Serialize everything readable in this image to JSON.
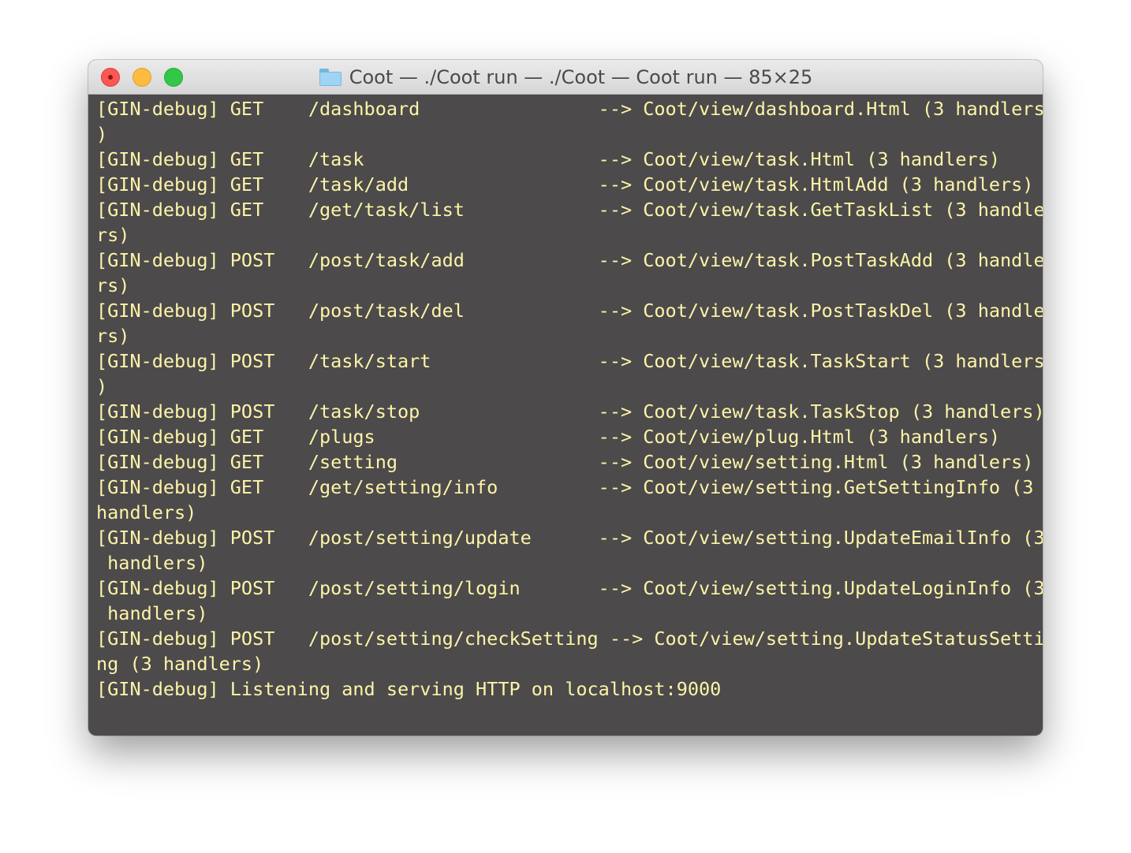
{
  "window": {
    "title": "Coot — ./Coot run — ./Coot — Coot run — 85×25",
    "title_icon": "folder-icon",
    "traffic_lights": {
      "close": "#fc5753",
      "minimize": "#fdbc40",
      "maximize": "#33c748"
    }
  },
  "terminal": {
    "background": "#4c4a4b",
    "foreground": "#fdf4a8",
    "lines": [
      "[GIN-debug] GET    /dashboard                --> Coot/view/dashboard.Html (3 handlers",
      ")",
      "[GIN-debug] GET    /task                     --> Coot/view/task.Html (3 handlers)",
      "[GIN-debug] GET    /task/add                 --> Coot/view/task.HtmlAdd (3 handlers)",
      "[GIN-debug] GET    /get/task/list            --> Coot/view/task.GetTaskList (3 handle",
      "rs)",
      "[GIN-debug] POST   /post/task/add            --> Coot/view/task.PostTaskAdd (3 handle",
      "rs)",
      "[GIN-debug] POST   /post/task/del            --> Coot/view/task.PostTaskDel (3 handle",
      "rs)",
      "[GIN-debug] POST   /task/start               --> Coot/view/task.TaskStart (3 handlers",
      ")",
      "[GIN-debug] POST   /task/stop                --> Coot/view/task.TaskStop (3 handlers)",
      "[GIN-debug] GET    /plugs                    --> Coot/view/plug.Html (3 handlers)",
      "[GIN-debug] GET    /setting                  --> Coot/view/setting.Html (3 handlers)",
      "[GIN-debug] GET    /get/setting/info         --> Coot/view/setting.GetSettingInfo (3",
      "handlers)",
      "[GIN-debug] POST   /post/setting/update      --> Coot/view/setting.UpdateEmailInfo (3",
      " handlers)",
      "[GIN-debug] POST   /post/setting/login       --> Coot/view/setting.UpdateLoginInfo (3",
      " handlers)",
      "[GIN-debug] POST   /post/setting/checkSetting --> Coot/view/setting.UpdateStatusSetti",
      "ng (3 handlers)",
      "[GIN-debug] Listening and serving HTTP on localhost:9000",
      ""
    ]
  }
}
